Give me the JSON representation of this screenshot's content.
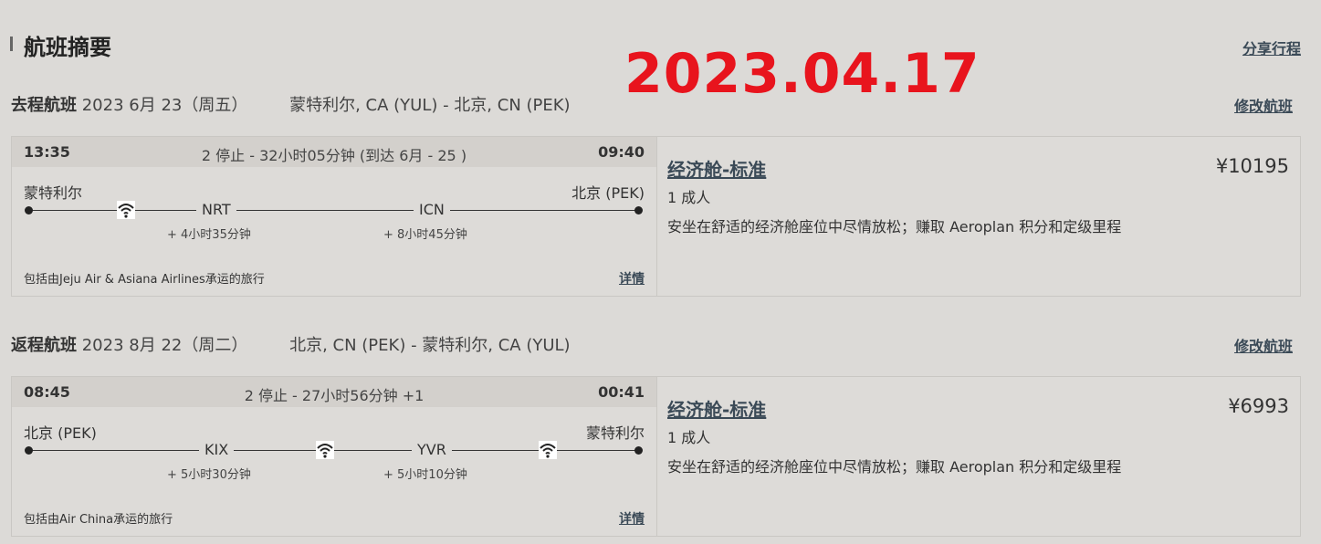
{
  "header": {
    "title": "航班摘要",
    "share_label": "分享行程"
  },
  "overlay_date": "2023.04.17",
  "outbound": {
    "label": "去程航班",
    "date": "2023 6月 23（周五）",
    "route": "蒙特利尔, CA (YUL) - 北京, CN (PEK)",
    "modify_label": "修改航班",
    "dep_time": "13:35",
    "summary": "2 停止 - 32小时05分钟 (到达 6月 - 25 )",
    "arr_time": "09:40",
    "origin": "蒙特利尔",
    "destination": "北京 (PEK)",
    "stops": [
      {
        "code": "NRT",
        "layover": "+ 4小时35分钟"
      },
      {
        "code": "ICN",
        "layover": "+ 8小时45分钟"
      }
    ],
    "operated_by": "包括由Jeju Air & Asiana Airlines承运的旅行",
    "details_label": "详情",
    "fare_name": "经济舱-标准",
    "price": "¥10195",
    "passengers": "1 成人",
    "fare_desc": "安坐在舒适的经济舱座位中尽情放松；赚取 Aeroplan 积分和定级里程"
  },
  "return": {
    "label": "返程航班",
    "date": "2023 8月 22（周二）",
    "route": "北京, CN (PEK) - 蒙特利尔, CA (YUL)",
    "modify_label": "修改航班",
    "dep_time": "08:45",
    "summary": "2 停止 - 27小时56分钟 +1",
    "arr_time": "00:41",
    "origin": "北京 (PEK)",
    "destination": "蒙特利尔",
    "stops": [
      {
        "code": "KIX",
        "layover": "+ 5小时30分钟"
      },
      {
        "code": "YVR",
        "layover": "+ 5小时10分钟"
      }
    ],
    "operated_by": "包括由Air China承运的旅行",
    "details_label": "详情",
    "fare_name": "经济舱-标准",
    "price": "¥6993",
    "passengers": "1 成人",
    "fare_desc": "安坐在舒适的经济舱座位中尽情放松；赚取 Aeroplan 积分和定级里程"
  },
  "icons": {
    "wifi": "wifi-icon"
  }
}
